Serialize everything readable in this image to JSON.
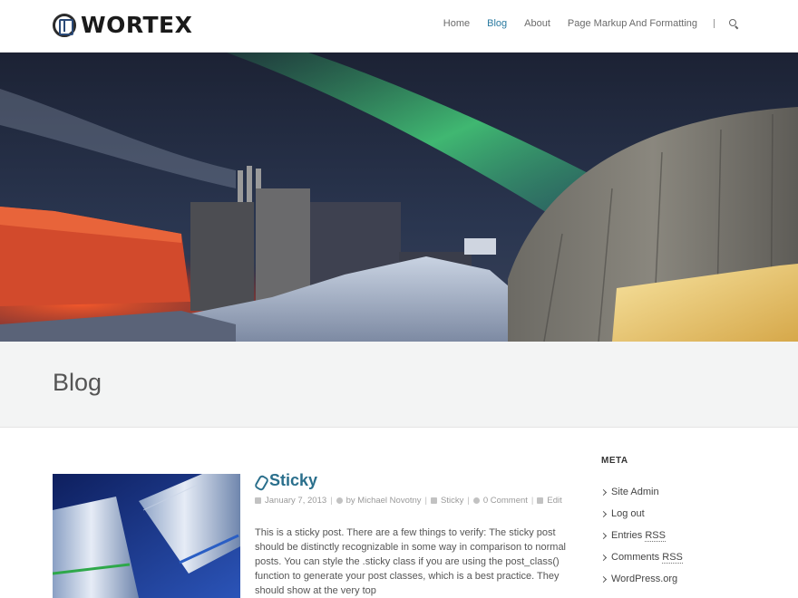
{
  "site": {
    "logo_text": "WORTEX"
  },
  "nav": {
    "items": [
      "Home",
      "Blog",
      "About",
      "Page Markup And Formatting"
    ],
    "active": "Blog"
  },
  "page": {
    "title": "Blog"
  },
  "post": {
    "title": "Sticky",
    "date": "January 7, 2013",
    "author_prefix": "by",
    "author": "Michael Novotny",
    "category": "Sticky",
    "comments": "0 Comment",
    "edit": "Edit",
    "excerpt": "This is a sticky post. There are a few things to verify: The sticky post should be distinctly recognizable in some way in comparison to normal posts. You can style the .sticky class if you are using the post_class() function to generate your post classes, which is a best practice. They should show at the very top"
  },
  "sidebar": {
    "heading": "META",
    "links": {
      "site_admin": "Site Admin",
      "log_out": "Log out",
      "entries_prefix": "Entries",
      "comments_prefix": "Comments",
      "rss": "RSS",
      "wordpress": "WordPress.org"
    }
  },
  "colors": {
    "accent": "#2a6f8c",
    "nav_active": "#2a7aa0",
    "title_band": "#f3f4f4"
  }
}
